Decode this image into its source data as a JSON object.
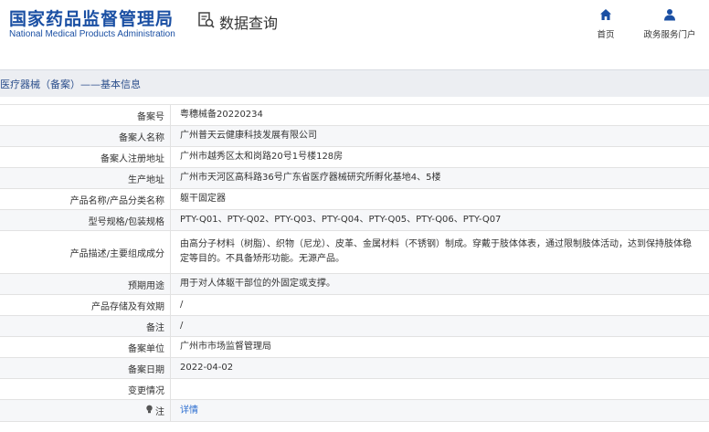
{
  "header": {
    "logo_cn": "国家药品监督管理局",
    "logo_en": "National Medical Products Administration",
    "query_label": "数据查询",
    "nav": [
      {
        "label": "首页",
        "icon": "home-icon"
      },
      {
        "label": "政务服务门户",
        "icon": "user-icon"
      }
    ]
  },
  "section": {
    "title": "医疗器械（备案）——基本信息"
  },
  "rows": [
    {
      "label": "备案号",
      "value": "粤穗械备20220234"
    },
    {
      "label": "备案人名称",
      "value": "广州普天云健康科技发展有限公司"
    },
    {
      "label": "备案人注册地址",
      "value": "广州市越秀区太和岗路20号1号楼128房"
    },
    {
      "label": "生产地址",
      "value": "广州市天河区高科路36号广东省医疗器械研究所孵化基地4、5楼"
    },
    {
      "label": "产品名称/产品分类名称",
      "value": "躯干固定器"
    },
    {
      "label": "型号规格/包装规格",
      "value": "PTY-Q01、PTY-Q02、PTY-Q03、PTY-Q04、PTY-Q05、PTY-Q06、PTY-Q07"
    },
    {
      "label": "产品描述/主要组成成分",
      "value": "由高分子材料（树脂）、织物（尼龙）、皮革、金属材料（不锈钢）制成。穿戴于肢体体表，通过限制肢体活动，达到保持肢体稳定等目的。不具备矫形功能。无源产品。"
    },
    {
      "label": "预期用途",
      "value": "用于对人体躯干部位的外固定或支撑。"
    },
    {
      "label": "产品存储及有效期",
      "value": "/"
    },
    {
      "label": "备注",
      "value": "/"
    },
    {
      "label": "备案单位",
      "value": "广州市市场监督管理局"
    },
    {
      "label": "备案日期",
      "value": "2022-04-02"
    },
    {
      "label": "变更情况",
      "value": ""
    },
    {
      "label": "注",
      "value": "详情",
      "icon": "bulb-icon"
    }
  ],
  "colors": {
    "brand": "#1a4fa3",
    "link": "#2c6ed0",
    "section_bg": "#eceef2"
  }
}
